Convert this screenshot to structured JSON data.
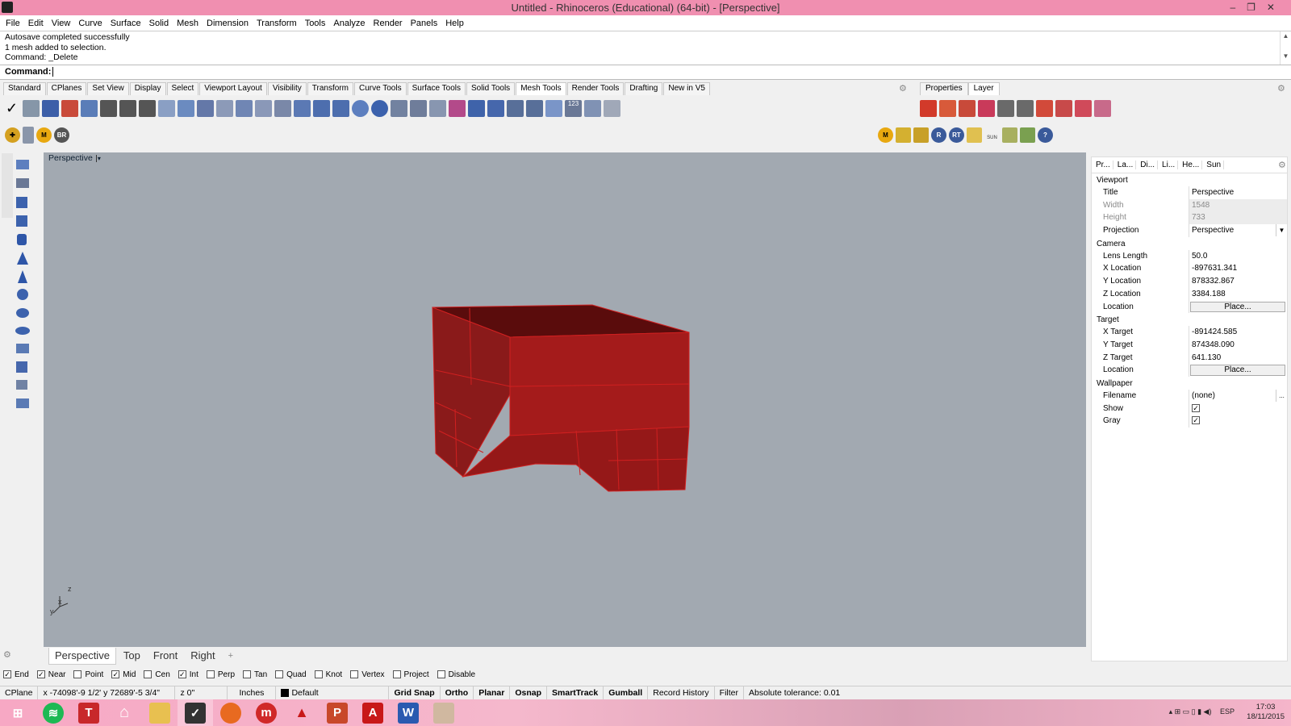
{
  "title_bar": {
    "title": "Untitled - Rhinoceros (Educational) (64-bit) - [Perspective]"
  },
  "menu": [
    "File",
    "Edit",
    "View",
    "Curve",
    "Surface",
    "Solid",
    "Mesh",
    "Dimension",
    "Transform",
    "Tools",
    "Analyze",
    "Render",
    "Panels",
    "Help"
  ],
  "command_history": {
    "line1": "Autosave completed successfully",
    "line2": "1 mesh added to selection.",
    "line3": "Command: _Delete"
  },
  "command_prompt": {
    "label": "Command:"
  },
  "toolbar_tabs": [
    "Standard",
    "CPlanes",
    "Set View",
    "Display",
    "Select",
    "Viewport Layout",
    "Visibility",
    "Transform",
    "Curve Tools",
    "Surface Tools",
    "Solid Tools",
    "Mesh Tools",
    "Render Tools",
    "Drafting",
    "New in V5"
  ],
  "active_toolbar_tab": "Mesh Tools",
  "panel_tabs": [
    "Properties",
    "Layer"
  ],
  "active_panel_tab": "Layer",
  "render_icon_labels": {
    "m": "M",
    "br": "BR",
    "r": "R",
    "rt": "RT",
    "sun": "SUN",
    "help": "?"
  },
  "viewport": {
    "label": "Perspective",
    "axis_z": "z",
    "axis_x": "x",
    "axis_y": "y",
    "background": "#a2a9b1",
    "object_color": "#a41b1b"
  },
  "viewport_tabs": [
    "Perspective",
    "Top",
    "Front",
    "Right"
  ],
  "viewport_tab_add": "+",
  "properties_panel": {
    "tabs": [
      "Pr...",
      "La...",
      "Di...",
      "Li...",
      "He...",
      "Sun"
    ],
    "viewport_section": "Viewport",
    "title_label": "Title",
    "title_value": "Perspective",
    "width_label": "Width",
    "width_value": "1548",
    "height_label": "Height",
    "height_value": "733",
    "projection_label": "Projection",
    "projection_value": "Perspective",
    "camera_section": "Camera",
    "lens_label": "Lens Length",
    "lens_value": "50.0",
    "xloc_label": "X Location",
    "xloc_value": "-897631.341",
    "yloc_label": "Y Location",
    "yloc_value": "878332.867",
    "zloc_label": "Z Location",
    "zloc_value": "3384.188",
    "loc_label": "Location",
    "place_label": "Place...",
    "target_section": "Target",
    "xt_label": "X Target",
    "xt_value": "-891424.585",
    "yt_label": "Y Target",
    "yt_value": "874348.090",
    "zt_label": "Z Target",
    "zt_value": "641.130",
    "tloc_label": "Location",
    "tplace_label": "Place...",
    "wallpaper_section": "Wallpaper",
    "filename_label": "Filename",
    "filename_value": "(none)",
    "browse_label": "...",
    "show_label": "Show",
    "show_checked": "✓",
    "gray_label": "Gray",
    "gray_checked": "✓"
  },
  "osnaps": [
    {
      "label": "End",
      "checked": "✓"
    },
    {
      "label": "Near",
      "checked": "✓"
    },
    {
      "label": "Point",
      "checked": ""
    },
    {
      "label": "Mid",
      "checked": "✓"
    },
    {
      "label": "Cen",
      "checked": ""
    },
    {
      "label": "Int",
      "checked": "✓"
    },
    {
      "label": "Perp",
      "checked": ""
    },
    {
      "label": "Tan",
      "checked": ""
    },
    {
      "label": "Quad",
      "checked": ""
    },
    {
      "label": "Knot",
      "checked": ""
    },
    {
      "label": "Vertex",
      "checked": ""
    },
    {
      "label": "Project",
      "checked": ""
    },
    {
      "label": "Disable",
      "checked": ""
    }
  ],
  "status_bar": {
    "cplane": "CPlane",
    "coords": "x -74098'-9 1/2'  y 72689'-5 3/4\"",
    "z": "z 0\"",
    "units": "Inches",
    "layer": "Default",
    "grid_snap": "Grid Snap",
    "ortho": "Ortho",
    "planar": "Planar",
    "osnap": "Osnap",
    "smarttrack": "SmartTrack",
    "gumball": "Gumball",
    "record_history": "Record History",
    "filter": "Filter",
    "tolerance": "Absolute tolerance: 0.01"
  },
  "taskbar": {
    "lang": "ESP",
    "time": "17:03",
    "date": "18/11/2015"
  }
}
